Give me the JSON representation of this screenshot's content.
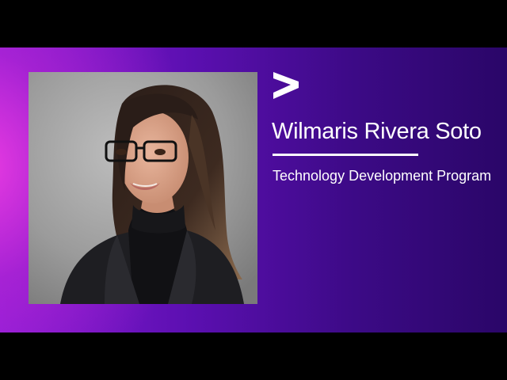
{
  "slide": {
    "name": "Wilmaris Rivera Soto",
    "program": "Technology Development Program",
    "logo_icon": "accenture-chevron-icon",
    "photo_icon": "portrait-photo",
    "colors": {
      "background_left": "#e83de0",
      "background_mid": "#5b0fb0",
      "background_right": "#2a0668",
      "text": "#ffffff",
      "letterbox": "#000000"
    }
  }
}
